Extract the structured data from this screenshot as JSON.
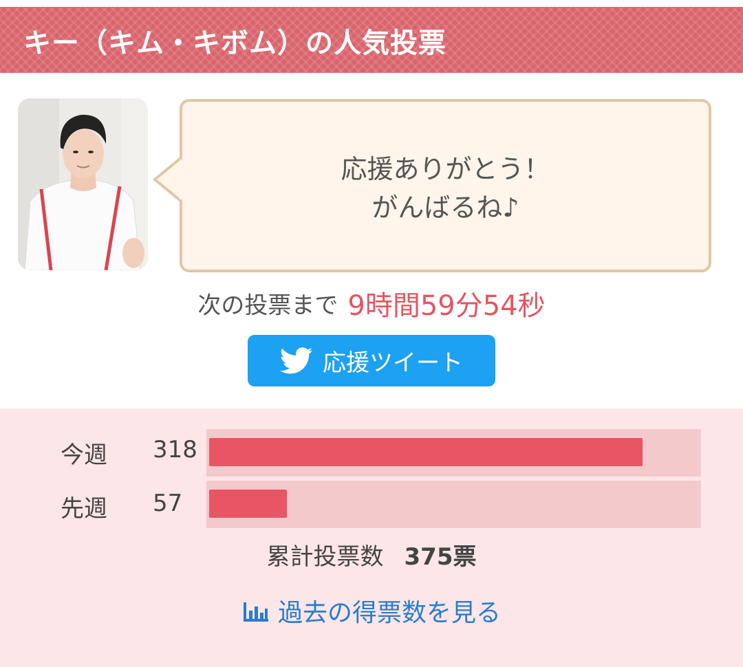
{
  "header": {
    "title": "キー（キム・キボム）の人気投票"
  },
  "bubble": {
    "line1": "応援ありがとう！",
    "line2": "がんばるね♪"
  },
  "countdown": {
    "label": "次の投票まで",
    "time": "9時間59分54秒"
  },
  "tweet_button": {
    "icon": "twitter-bird-icon",
    "label": "応援ツイート"
  },
  "stats": {
    "max_votes": 359,
    "rows": [
      {
        "label": "今週",
        "count": "318",
        "votes": 318
      },
      {
        "label": "先週",
        "count": "57",
        "votes": 57
      }
    ],
    "total_label": "累計投票数",
    "total_value": "375票",
    "history_icon": "bar-chart-icon",
    "history_label": "過去の得票数を見る"
  },
  "colors": {
    "header_bg": "#d9646c",
    "accent_red": "#e65560",
    "twitter_blue": "#1da1f2",
    "link_blue": "#2b7dc7",
    "stats_bg": "#fde6e8",
    "bar_track": "#f3c9cc",
    "bar_fill": "#e75662",
    "bubble_bg": "#fff5ea",
    "bubble_border": "#dfc7a6"
  }
}
